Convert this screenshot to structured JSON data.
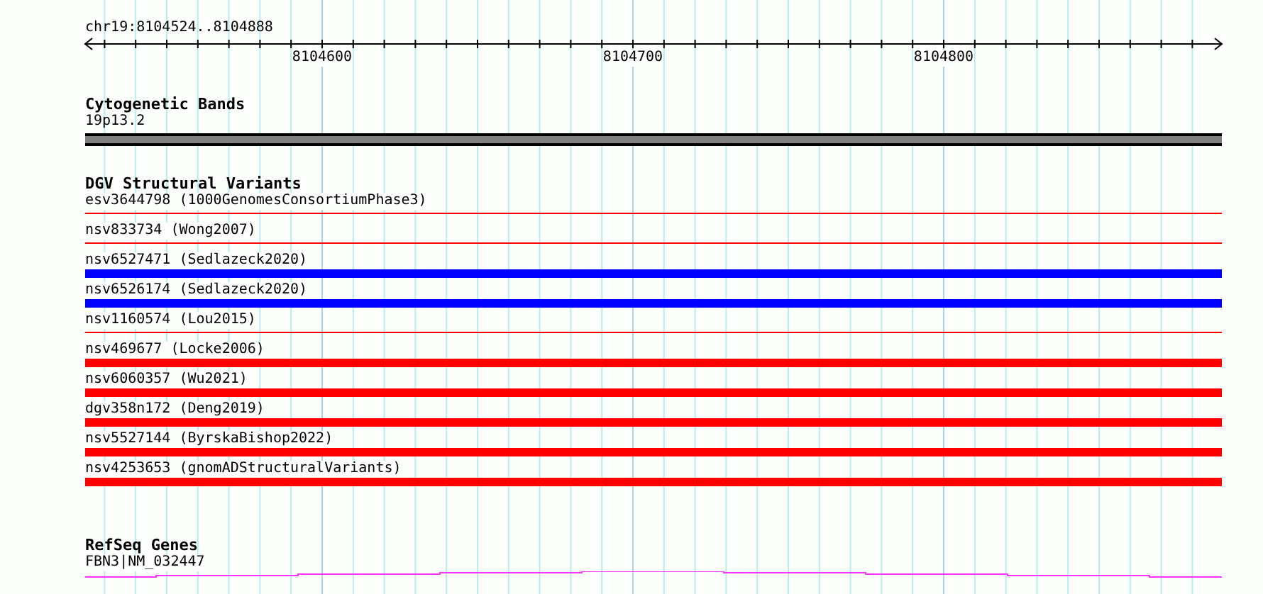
{
  "ruler": {
    "location": "chr19:8104524..8104888",
    "labels": [
      "8104600",
      "8104700",
      "8104800"
    ]
  },
  "tracks": [
    {
      "kind": "bands",
      "title": "Cytogenetic Bands",
      "features": [
        {
          "name": "19p13.2"
        }
      ]
    },
    {
      "kind": "variants",
      "title": "DGV Structural Variants",
      "features": [
        {
          "name": "esv3644798 (1000GenomesConsortiumPhase3)",
          "kind": "thin",
          "color": "#ff0000"
        },
        {
          "name": "nsv833734 (Wong2007)",
          "kind": "thin",
          "color": "#ff0000"
        },
        {
          "name": "nsv6527471 (Sedlazeck2020)",
          "kind": "thick",
          "color": "#0000ff"
        },
        {
          "name": "nsv6526174 (Sedlazeck2020)",
          "kind": "thick",
          "color": "#0000ff"
        },
        {
          "name": "nsv1160574 (Lou2015)",
          "kind": "thin",
          "color": "#ff0000"
        },
        {
          "name": "nsv469677 (Locke2006)",
          "kind": "thick",
          "color": "#ff0000"
        },
        {
          "name": "nsv6060357 (Wu2021)",
          "kind": "thick",
          "color": "#ff0000"
        },
        {
          "name": "dgv358n172 (Deng2019)",
          "kind": "thick",
          "color": "#ff0000"
        },
        {
          "name": "nsv5527144 (ByrskaBishop2022)",
          "kind": "thick",
          "color": "#ff0000"
        },
        {
          "name": "nsv4253653 (gnomADStructuralVariants)",
          "kind": "thick",
          "color": "#ff0000"
        }
      ]
    },
    {
      "kind": "genes",
      "title": "RefSeq Genes",
      "features": [
        {
          "name": "FBN3|NM_032447"
        }
      ]
    }
  ]
}
